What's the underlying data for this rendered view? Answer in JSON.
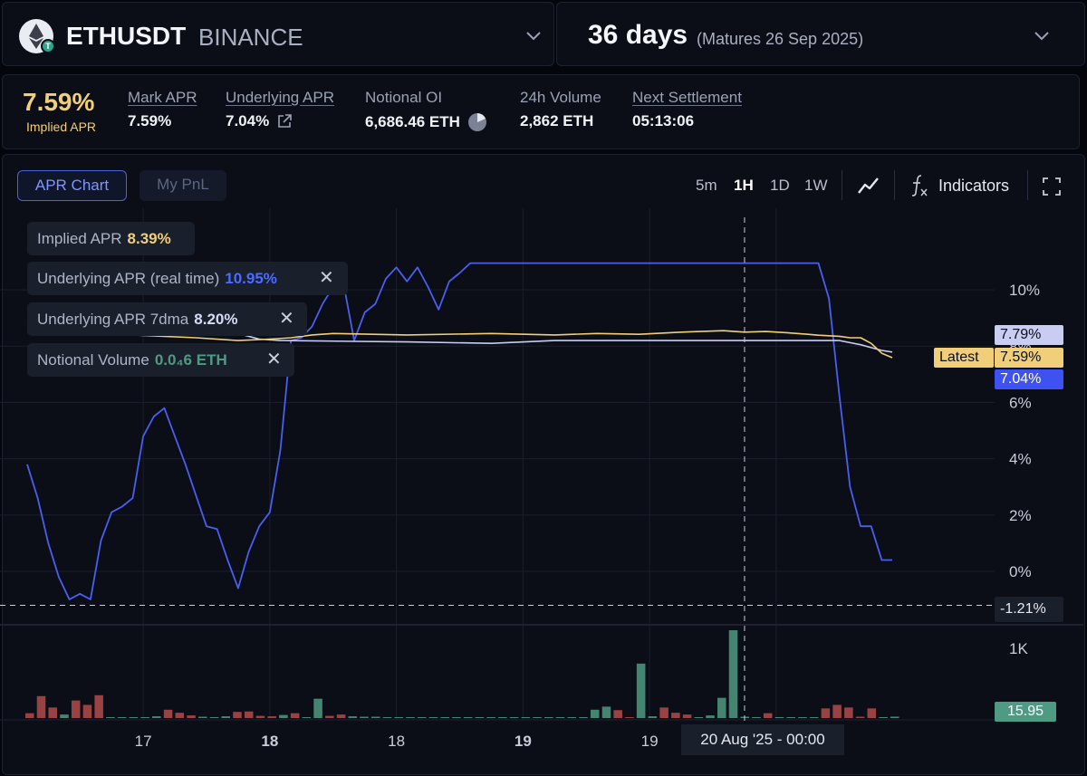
{
  "header": {
    "symbol": "ETHUSDT",
    "exchange": "BINANCE",
    "days": "36 days",
    "matures": "(Matures 26 Sep 2025)"
  },
  "stats": {
    "implied_apr_value": "7.59%",
    "implied_apr_label": "Implied APR",
    "mark_apr_label": "Mark APR",
    "mark_apr_value": "7.59%",
    "underlying_apr_label": "Underlying APR",
    "underlying_apr_value": "7.04%",
    "notional_oi_label": "Notional OI",
    "notional_oi_value": "6,686.46 ETH",
    "volume_label": "24h Volume",
    "volume_value": "2,862 ETH",
    "settlement_label": "Next Settlement",
    "settlement_value": "05:13:06"
  },
  "tabs": {
    "apr_chart": "APR Chart",
    "my_pnl": "My PnL"
  },
  "toolbar": {
    "timeframes": [
      "5m",
      "1H",
      "1D",
      "1W"
    ],
    "active_timeframe": "1H",
    "indicators": "Indicators"
  },
  "legend": {
    "implied_label": "Implied APR",
    "implied_value": "8.39%",
    "underlying_rt_label": "Underlying APR (real time)",
    "underlying_rt_value": "10.95%",
    "underlying_7dma_label": "Underlying APR 7dma",
    "underlying_7dma_value": "8.20%",
    "notional_volume_label": "Notional Volume",
    "notional_volume_value": "0.0₄6 ETH"
  },
  "tags": {
    "underlying_7dma": "7.79%",
    "latest_label": "Latest",
    "latest": "7.59%",
    "underlying": "7.04%",
    "crosshair": "-1.21%",
    "volume": "15.95",
    "crosshair_time": "20 Aug '25 - 00:00",
    "partial_8": "8%",
    "partial_6": "6%"
  },
  "colors": {
    "implied": "#f1cf7a",
    "underlying": "#4a5ff0",
    "underlying_7dma": "#c9cdf2",
    "volume_up": "#4f9a82",
    "volume_down": "#b24b4b",
    "accent": "#4b63d8"
  },
  "chart_data": {
    "type": "line",
    "y_ticks": [
      "10%",
      "8%",
      "6%",
      "4%",
      "2%",
      "0%"
    ],
    "y_ticks_visible": [
      "10%",
      "4%",
      "2%",
      "0%"
    ],
    "ylim": [
      -1.9,
      12.9
    ],
    "x_ticks": [
      "17",
      "18",
      "18",
      "19",
      "19",
      "20"
    ],
    "x_tick_bold": [
      false,
      true,
      false,
      true,
      false,
      false
    ],
    "x_tick_pos": [
      5.5,
      11.5,
      17.5,
      23.5,
      29.5,
      35.5
    ],
    "x_range": [
      0,
      41
    ],
    "grid": true,
    "crosshair_x": 34,
    "crosshair_y": -1.21,
    "series": [
      {
        "name": "Underlying APR (real time)",
        "color": "#4a5ff0",
        "points": [
          [
            0,
            3.8
          ],
          [
            0.5,
            2.6
          ],
          [
            1,
            1
          ],
          [
            1.5,
            -0.2
          ],
          [
            2,
            -1
          ],
          [
            2.5,
            -0.8
          ],
          [
            3,
            -1
          ],
          [
            3.5,
            1.1
          ],
          [
            4,
            2.1
          ],
          [
            4.5,
            2.3
          ],
          [
            5,
            2.6
          ],
          [
            5.5,
            4.8
          ],
          [
            6,
            5.5
          ],
          [
            6.5,
            5.8
          ],
          [
            7,
            4.8
          ],
          [
            7.5,
            3.8
          ],
          [
            8,
            2.7
          ],
          [
            8.5,
            1.6
          ],
          [
            9,
            1.5
          ],
          [
            9.5,
            0.4
          ],
          [
            10,
            -0.6
          ],
          [
            10.5,
            0.7
          ],
          [
            11,
            1.6
          ],
          [
            11.5,
            2.1
          ],
          [
            12,
            4.3
          ],
          [
            12.5,
            8.2
          ],
          [
            13,
            8.3
          ],
          [
            13.5,
            8.7
          ],
          [
            14,
            9.5
          ],
          [
            14.5,
            10.1
          ],
          [
            15,
            10.2
          ],
          [
            15.5,
            8.2
          ],
          [
            16,
            9.2
          ],
          [
            16.5,
            9.5
          ],
          [
            17,
            10.4
          ],
          [
            17.5,
            10.8
          ],
          [
            18,
            10.3
          ],
          [
            18.5,
            10.8
          ],
          [
            19,
            10.1
          ],
          [
            19.5,
            9.3
          ],
          [
            20,
            10.3
          ],
          [
            20.5,
            10.6
          ],
          [
            21,
            10.95
          ],
          [
            37.5,
            10.95
          ],
          [
            38,
            9.7
          ],
          [
            38.5,
            6.2
          ],
          [
            39,
            3
          ],
          [
            39.5,
            1.6
          ],
          [
            40,
            1.6
          ],
          [
            40.5,
            0.4
          ],
          [
            41,
            0.4
          ]
        ]
      },
      {
        "name": "Underlying APR 7dma",
        "color": "#c9cdf2",
        "points": [
          [
            0,
            9.35
          ],
          [
            4,
            9.1
          ],
          [
            8,
            8.7
          ],
          [
            10,
            8.45
          ],
          [
            11,
            8.25
          ],
          [
            12,
            8.2
          ],
          [
            18,
            8.15
          ],
          [
            22,
            8.1
          ],
          [
            25,
            8.2
          ],
          [
            30,
            8.2
          ],
          [
            35,
            8.2
          ],
          [
            37.5,
            8.2
          ],
          [
            38.5,
            8.2
          ],
          [
            39.5,
            8.05
          ],
          [
            40.5,
            7.85
          ],
          [
            41,
            7.79
          ]
        ]
      },
      {
        "name": "Implied APR",
        "color": "#f1cf7a",
        "points": [
          [
            0,
            8.8
          ],
          [
            1,
            8.7
          ],
          [
            3,
            8.5
          ],
          [
            5,
            8.4
          ],
          [
            8,
            8.3
          ],
          [
            10,
            8.2
          ],
          [
            11.5,
            8.25
          ],
          [
            12.5,
            8.3
          ],
          [
            13.5,
            8.4
          ],
          [
            14.5,
            8.45
          ],
          [
            18,
            8.4
          ],
          [
            22,
            8.45
          ],
          [
            25,
            8.4
          ],
          [
            27,
            8.45
          ],
          [
            29,
            8.42
          ],
          [
            31,
            8.5
          ],
          [
            33,
            8.55
          ],
          [
            34,
            8.5
          ],
          [
            35,
            8.52
          ],
          [
            36,
            8.48
          ],
          [
            37,
            8.42
          ],
          [
            37.5,
            8.39
          ],
          [
            38,
            8.37
          ],
          [
            38.5,
            8.35
          ],
          [
            39,
            8.3
          ],
          [
            39.5,
            8.3
          ],
          [
            40,
            8.1
          ],
          [
            40.5,
            7.75
          ],
          [
            41,
            7.59
          ]
        ]
      }
    ],
    "volume_series": {
      "name": "Notional Volume",
      "axis_label": "1K",
      "values": [
        55,
        250,
        120,
        40,
        200,
        150,
        260,
        10,
        8,
        6,
        8,
        20,
        95,
        60,
        30,
        15,
        10,
        20,
        70,
        75,
        25,
        20,
        35,
        55,
        10,
        220,
        25,
        40,
        20,
        15,
        15,
        5,
        5,
        5,
        5,
        5,
        3,
        5,
        5,
        5,
        3,
        4,
        4,
        5,
        5,
        6,
        5,
        5,
        5,
        95,
        130,
        90,
        10,
        620,
        20,
        120,
        60,
        40,
        10,
        30,
        230,
        1000,
        15,
        5,
        55,
        5,
        5,
        5,
        5,
        110,
        150,
        120,
        15,
        110,
        5,
        15.95
      ],
      "colors": [
        "d",
        "d",
        "d",
        "u",
        "d",
        "d",
        "d",
        "u",
        "u",
        "u",
        "u",
        "u",
        "d",
        "d",
        "d",
        "u",
        "u",
        "u",
        "d",
        "d",
        "d",
        "d",
        "u",
        "d",
        "u",
        "u",
        "d",
        "d",
        "u",
        "u",
        "u",
        "u",
        "u",
        "u",
        "u",
        "u",
        "u",
        "u",
        "u",
        "u",
        "u",
        "u",
        "u",
        "u",
        "u",
        "u",
        "u",
        "u",
        "u",
        "u",
        "u",
        "d",
        "d",
        "u",
        "u",
        "d",
        "d",
        "d",
        "u",
        "u",
        "u",
        "u",
        "u",
        "u",
        "d",
        "u",
        "u",
        "u",
        "u",
        "d",
        "d",
        "d",
        "d",
        "d",
        "u",
        "u"
      ]
    }
  }
}
